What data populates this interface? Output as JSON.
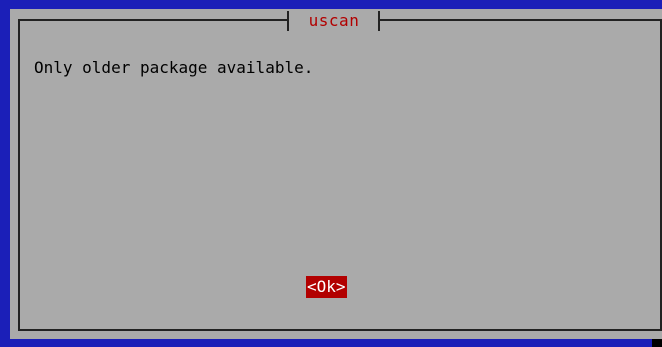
{
  "dialog": {
    "title": "uscan",
    "message": "Only older package available.",
    "ok_label": "<Ok>"
  },
  "colors": {
    "screen_background": "#1b1fb8",
    "dialog_background": "#aaaaaa",
    "title_text": "#b20000",
    "button_background": "#b20000",
    "button_text": "#ffffff"
  }
}
